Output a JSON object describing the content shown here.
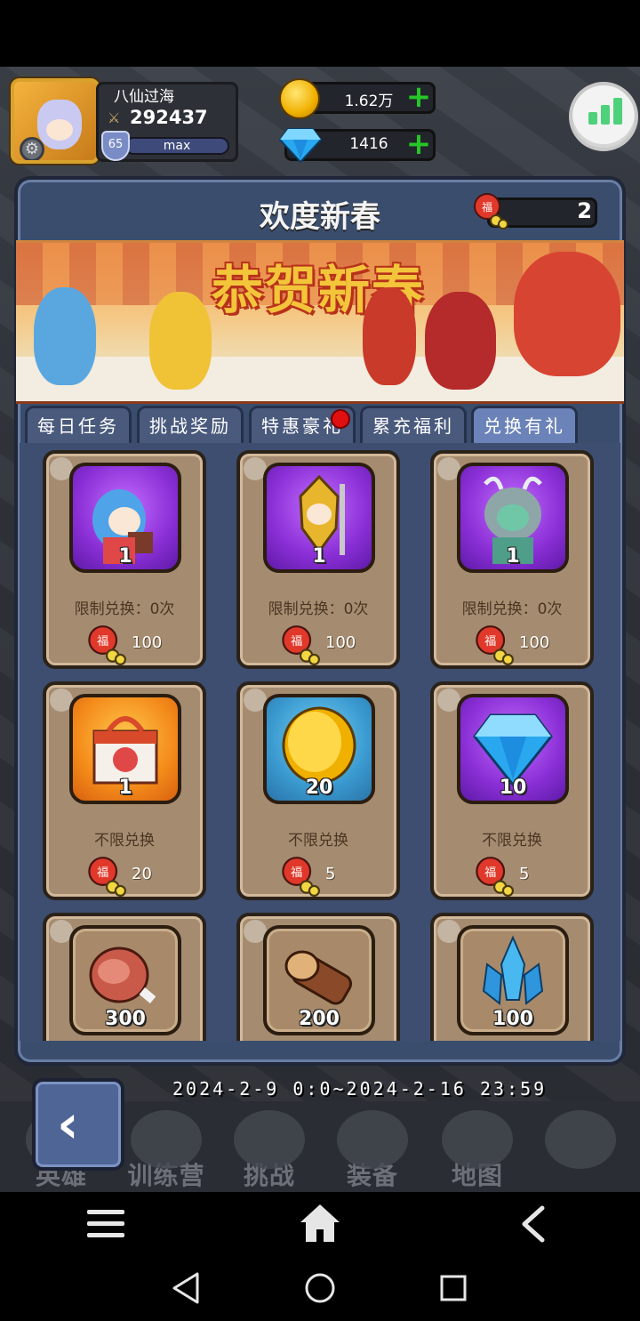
{
  "player": {
    "name": "八仙过海",
    "power": "292437",
    "level": "65",
    "exp": "max"
  },
  "resources": {
    "gold": "1.62万",
    "gems": "1416"
  },
  "panel": {
    "title": "欢度新春",
    "token_count": "2",
    "banner_text": "恭贺新春"
  },
  "tabs": [
    {
      "label": "每日任务",
      "active": false
    },
    {
      "label": "挑战奖励",
      "active": false
    },
    {
      "label": "特惠豪礼",
      "active": false,
      "badge": "red-dot"
    },
    {
      "label": "累充福利",
      "active": false
    },
    {
      "label": "兑换有礼",
      "active": true
    }
  ],
  "shop_items": [
    {
      "name": "hero-nurse",
      "qty": "1",
      "limit": "限制兑换：0次",
      "cost": "100",
      "frame": "purple"
    },
    {
      "name": "hero-golden-warrior",
      "qty": "1",
      "limit": "限制兑换：0次",
      "cost": "100",
      "frame": "purple"
    },
    {
      "name": "hero-dragon-girl",
      "qty": "1",
      "limit": "限制兑换：0次",
      "cost": "100",
      "frame": "purple"
    },
    {
      "name": "gift-box",
      "qty": "1",
      "limit": "不限兑换",
      "cost": "20",
      "frame": "orange"
    },
    {
      "name": "gold-coin",
      "qty": "20",
      "limit": "不限兑换",
      "cost": "5",
      "frame": "blue"
    },
    {
      "name": "diamond",
      "qty": "10",
      "limit": "不限兑换",
      "cost": "5",
      "frame": "purple"
    },
    {
      "name": "meat",
      "qty": "300",
      "frame": "brown"
    },
    {
      "name": "wood",
      "qty": "200",
      "frame": "brown"
    },
    {
      "name": "crystal",
      "qty": "100",
      "frame": "brown"
    }
  ],
  "event_time": "2024-2-9 0:0~2024-2-16 23:59",
  "bottom_nav": [
    {
      "label": "英雄"
    },
    {
      "label": "训练营"
    },
    {
      "label": "挑战"
    },
    {
      "label": "装备"
    },
    {
      "label": "地图"
    },
    {
      "label": ""
    }
  ],
  "colors": {
    "panel": "#3b4d6d",
    "card": "#a58c70",
    "accent_green": "#27c627",
    "badge_red": "#e01010"
  }
}
